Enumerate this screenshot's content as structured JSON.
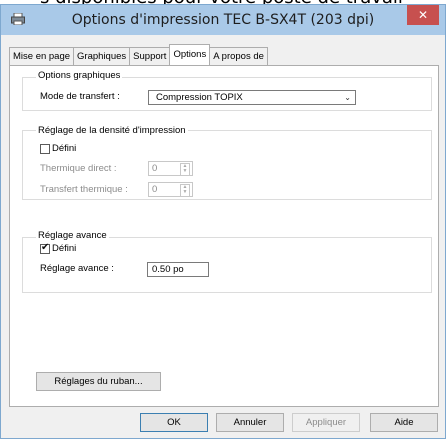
{
  "background_text": "s disponibles pour votre poste de travail",
  "window": {
    "title": "Options d'impression TEC B-SX4T (203 dpi)",
    "close_glyph": "✕"
  },
  "tabs": [
    {
      "label": "Mise en page"
    },
    {
      "label": "Graphiques"
    },
    {
      "label": "Support"
    },
    {
      "label": "Options",
      "active": true
    },
    {
      "label": "A propos de"
    }
  ],
  "graphics_group": {
    "title": "Options graphiques",
    "transfer_mode_label": "Mode de transfert :",
    "transfer_mode_value": "Compression TOPIX"
  },
  "density_group": {
    "title": "Réglage de la densité d'impression",
    "defined_label": "Défini",
    "defined_checked": false,
    "direct_thermal_label": "Thermique direct :",
    "direct_thermal_value": "0",
    "thermal_transfer_label": "Transfert thermique :",
    "thermal_transfer_value": "0"
  },
  "advanced_group": {
    "title": "Réglage avance",
    "defined_label": "Défini",
    "defined_checked": true,
    "advance_label": "Réglage avance :",
    "advance_value": "0.50 po"
  },
  "ribbon_button": "Réglages du ruban...",
  "footer": {
    "ok": "OK",
    "cancel": "Annuler",
    "apply": "Appliquer",
    "help": "Aide"
  }
}
